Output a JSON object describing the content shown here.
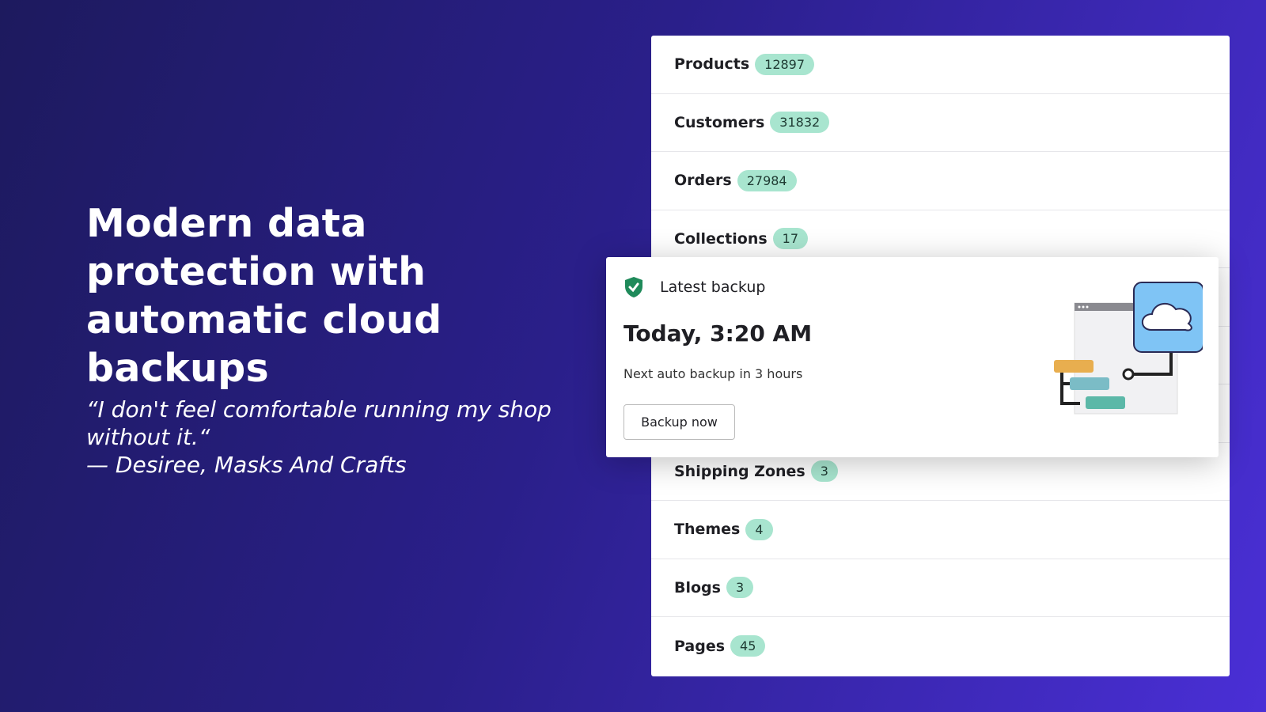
{
  "headline": "Modern data protection with automatic cloud backups",
  "quote": {
    "text": "“I don't feel comfortable running my shop without it.“",
    "author": "—  Desiree, Masks And Crafts"
  },
  "rows_top": [
    {
      "label": "Products",
      "count": "12897"
    },
    {
      "label": "Customers",
      "count": "31832"
    },
    {
      "label": "Orders",
      "count": "27984"
    },
    {
      "label": "Collections",
      "count": "17"
    }
  ],
  "rows_bottom": [
    {
      "label": "Shipping Zones",
      "count": "3"
    },
    {
      "label": "Themes",
      "count": "4"
    },
    {
      "label": "Blogs",
      "count": "3"
    },
    {
      "label": "Pages",
      "count": "45"
    }
  ],
  "backup": {
    "title": "Latest backup",
    "time": "Today, 3:20 AM",
    "next": "Next auto backup in 3 hours",
    "button": "Backup now",
    "icon": "shield-check-icon",
    "illustration": "cloud-backup-illustration"
  },
  "colors": {
    "badge": "#a8e5cf",
    "shield": "#1f8a5a",
    "bg_start": "#1d1a5e",
    "bg_end": "#4a2fd6"
  }
}
